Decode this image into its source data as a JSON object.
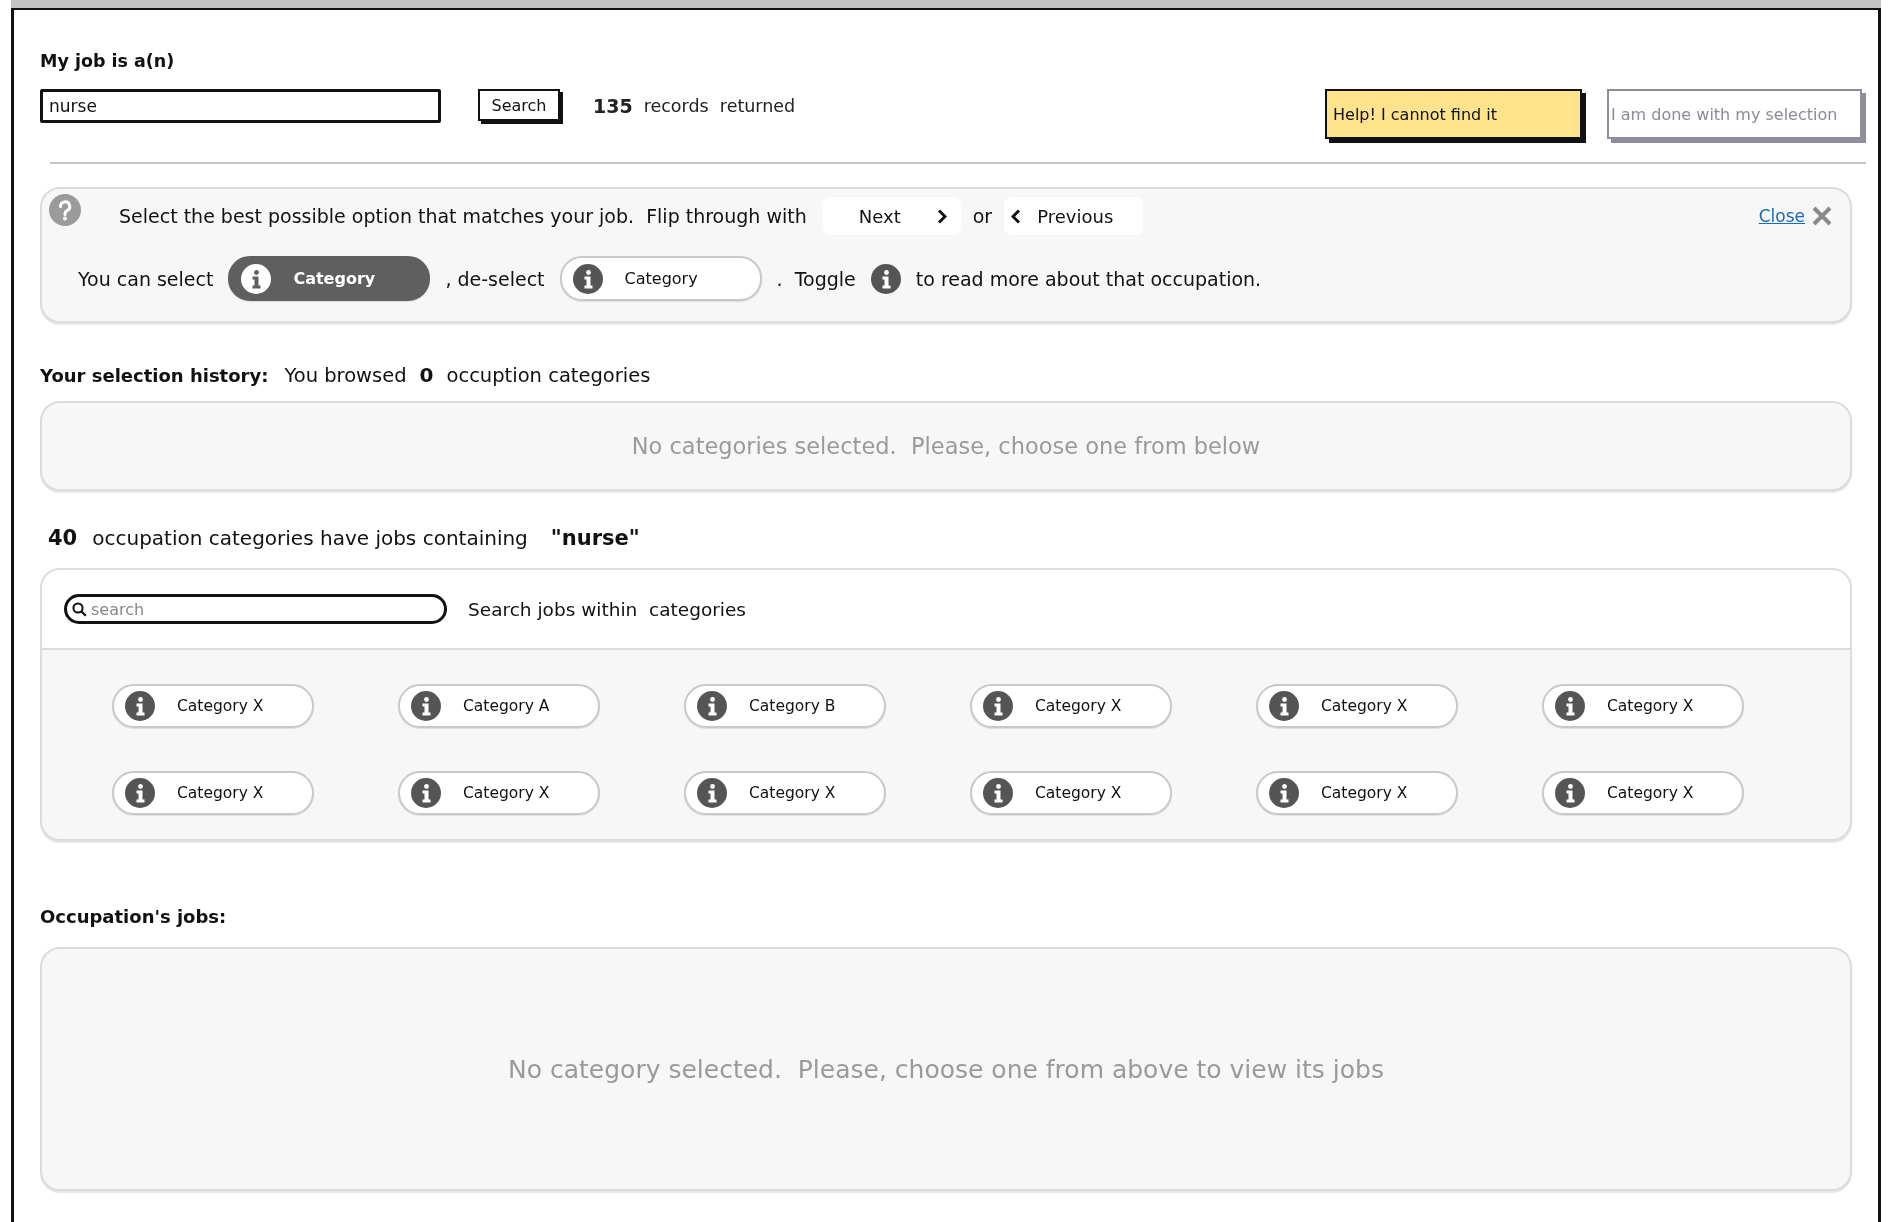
{
  "job_search": {
    "label": "My job is a(n)",
    "value": "nurse",
    "button": "Search",
    "record_count": "135",
    "records_text": "records  returned"
  },
  "actions": [
    {
      "label": "Help! I cannot find it",
      "kind": "warning",
      "disabled": false
    },
    {
      "label": "I am done with my selection",
      "kind": "plain",
      "disabled": true
    }
  ],
  "help_panel": {
    "text": "Select the best possible option that matches your job.  Flip through with",
    "next": "Next",
    "or": "or",
    "previous": "Previous",
    "close": "Close",
    "select_text": "You can select",
    "select_example": {
      "label": "Category",
      "selected": true
    },
    "deselect_text": ", de-select",
    "deselect_example": {
      "label": "Category",
      "selected": false
    },
    "toggle_text": ".  Toggle",
    "info_text": "to read more about that occupation."
  },
  "selection_history": {
    "label": "Your selection history:",
    "browsed_text": "You browsed",
    "count": "0",
    "count_suffix": "occuption categories",
    "empty_message": "No categories selected.  Please, choose one from below"
  },
  "categories": {
    "count": "40",
    "text": "occupation categories have jobs containing",
    "query": "\"nurse\"",
    "search_placeholder": "search",
    "search_label": "Search jobs within  categories",
    "items": [
      {
        "label": "Category X",
        "selected": false
      },
      {
        "label": "Category A",
        "selected": false
      },
      {
        "label": "Category B",
        "selected": false
      },
      {
        "label": "Category X",
        "selected": false
      },
      {
        "label": "Category X",
        "selected": false
      },
      {
        "label": "Category X",
        "selected": false
      },
      {
        "label": "Category X",
        "selected": false
      },
      {
        "label": "Category X",
        "selected": false
      },
      {
        "label": "Category X",
        "selected": false
      },
      {
        "label": "Category X",
        "selected": false
      },
      {
        "label": "Category X",
        "selected": false
      },
      {
        "label": "Category X",
        "selected": false
      }
    ]
  },
  "jobs": {
    "label": "Occupation's jobs:",
    "empty_message": "No category selected.  Please, choose one from above to view its jobs"
  }
}
